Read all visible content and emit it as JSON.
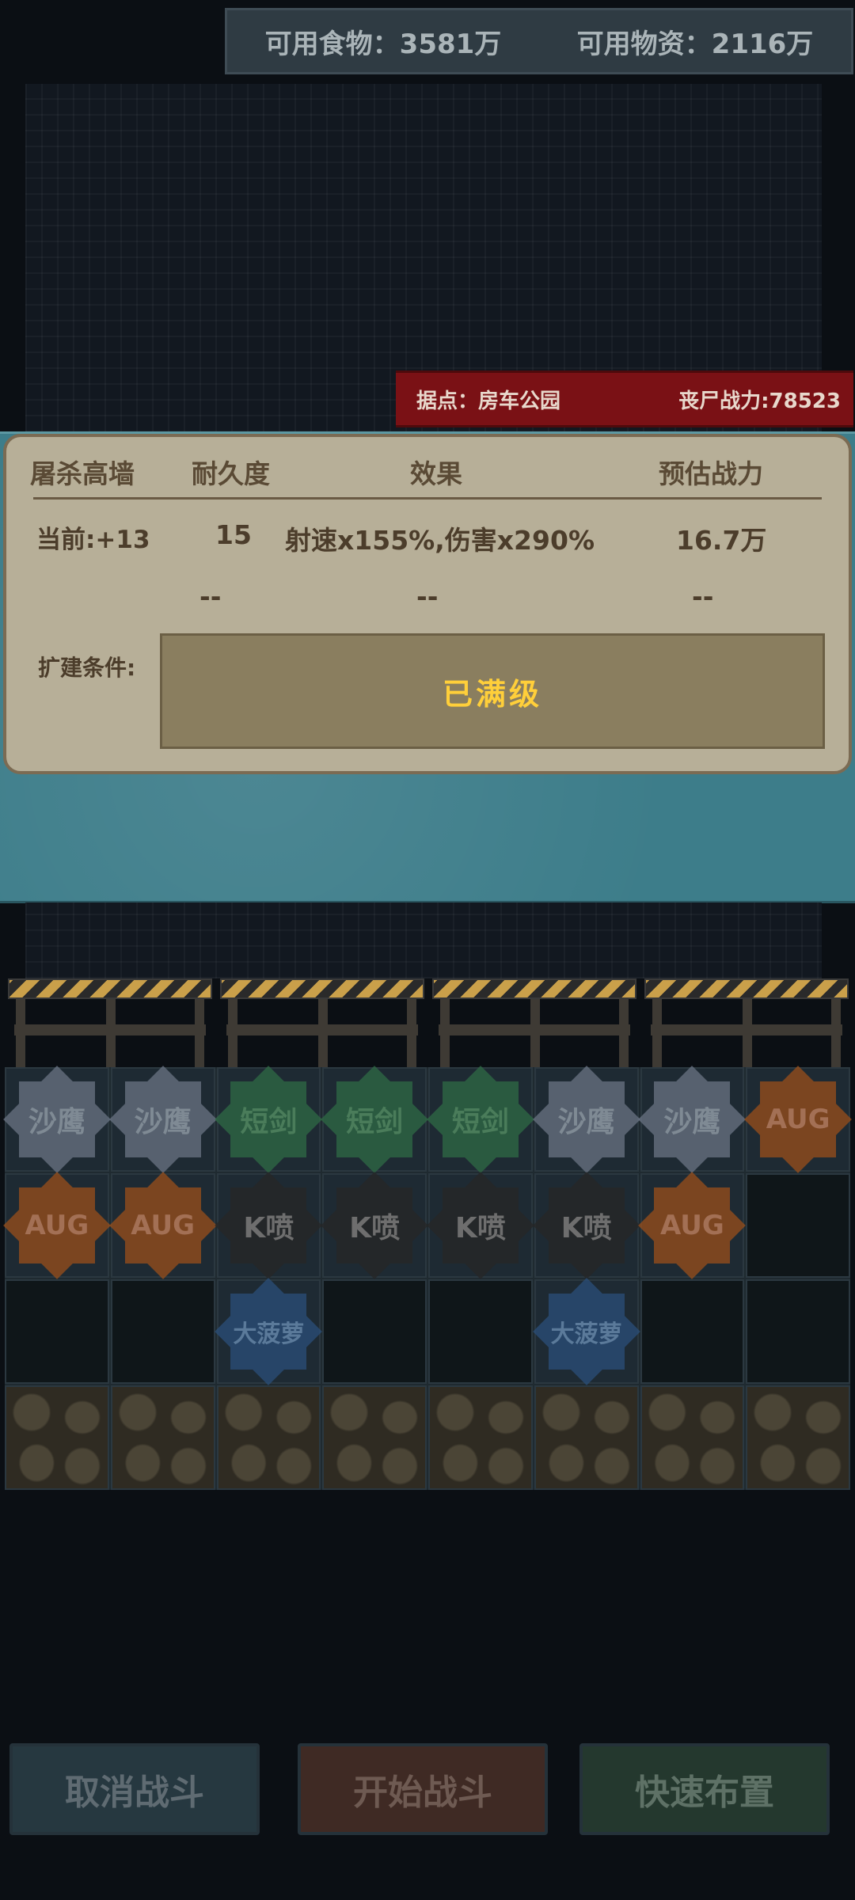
{
  "resources": {
    "food": "可用食物：3581万",
    "supplies": "可用物资：2116万"
  },
  "stronghold": {
    "location": "据点：房车公园",
    "zombie_power": "丧尸战力:78523"
  },
  "info": {
    "headers": {
      "name": "屠杀高墙",
      "durability": "耐久度",
      "effect": "效果",
      "power": "预估战力"
    },
    "current": {
      "level": "当前:+13",
      "durability": "15",
      "effect": "射速x155%,伤害x290%",
      "power": "16.7万"
    },
    "next": {
      "durability": "--",
      "effect": "--",
      "power": "--"
    },
    "expand_label": "扩建条件:",
    "max_level": "已满级"
  },
  "grid": {
    "rows": [
      [
        {
          "label": "沙鹰",
          "color": "gray"
        },
        {
          "label": "沙鹰",
          "color": "gray"
        },
        {
          "label": "短剑",
          "color": "green"
        },
        {
          "label": "短剑",
          "color": "green"
        },
        {
          "label": "短剑",
          "color": "green"
        },
        {
          "label": "沙鹰",
          "color": "gray"
        },
        {
          "label": "沙鹰",
          "color": "gray"
        },
        {
          "label": "AUG",
          "color": "orange"
        }
      ],
      [
        {
          "label": "AUG",
          "color": "orange"
        },
        {
          "label": "AUG",
          "color": "orange"
        },
        {
          "label": "K喷",
          "color": "black"
        },
        {
          "label": "K喷",
          "color": "black"
        },
        {
          "label": "K喷",
          "color": "black"
        },
        {
          "label": "K喷",
          "color": "black"
        },
        {
          "label": "AUG",
          "color": "orange"
        },
        {
          "label": "",
          "color": "empty"
        }
      ],
      [
        {
          "label": "",
          "color": "empty"
        },
        {
          "label": "",
          "color": "empty"
        },
        {
          "label": "大菠萝",
          "color": "blue"
        },
        {
          "label": "",
          "color": "empty"
        },
        {
          "label": "",
          "color": "empty"
        },
        {
          "label": "大菠萝",
          "color": "blue"
        },
        {
          "label": "",
          "color": "empty"
        },
        {
          "label": "",
          "color": "empty"
        }
      ]
    ]
  },
  "buttons": {
    "cancel": "取消战斗",
    "start": "开始战斗",
    "quick": "快速布置"
  }
}
